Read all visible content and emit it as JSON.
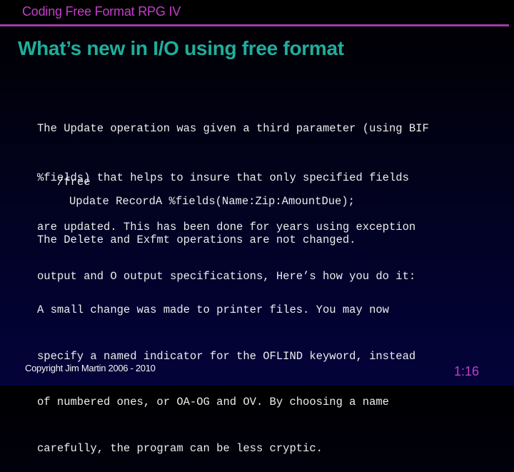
{
  "header": {
    "course_title": "Coding Free Format RPG IV",
    "accent_color": "#c43ec8",
    "rule_color": "#a63aa9"
  },
  "slide": {
    "title": "What’s new in I/O using free format",
    "title_color": "#1fae9c",
    "paragraph1_lines": [
      "The Update operation was given a third parameter (using BIF",
      "%fields) that helps to insure that only specified fields",
      "are updated. This has been done for years using exception",
      "output and O output specifications, Here’s how you do it:"
    ],
    "code": {
      "directive": "/free",
      "statement": "Update RecordA %fields(Name:Zip:AmountDue);"
    },
    "paragraph2": "The Delete and Exfmt operations are not changed.",
    "paragraph3_lines": [
      "A small change was made to printer files. You may now",
      "specify a named indicator for the OFLIND keyword, instead",
      "of numbered ones, or OA-OG and OV. By choosing a name",
      "carefully, the program can be less cryptic."
    ]
  },
  "footer": {
    "copyright": "Copyright Jim Martin 2006 - 2010",
    "page_number": "1:16"
  }
}
